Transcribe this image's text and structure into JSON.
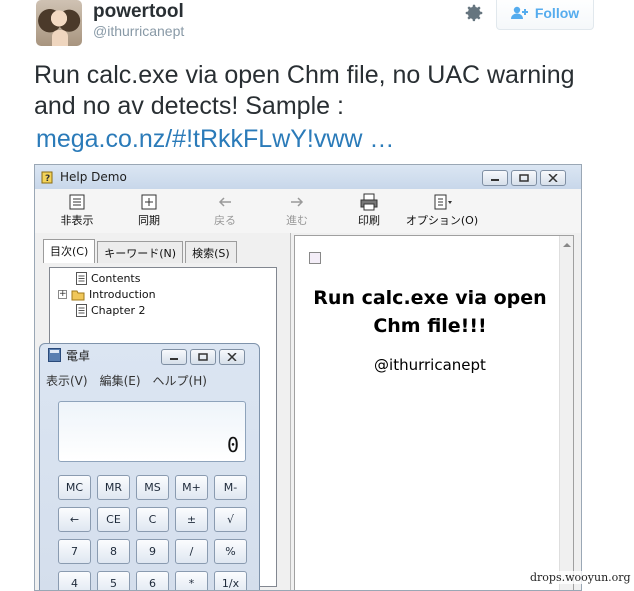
{
  "tweet": {
    "display_name": "powertool",
    "handle": "@ithurricanept",
    "follow_label": "Follow",
    "text": "Run calc.exe via open Chm file, no UAC warning and no av detects!  Sample :",
    "link": "mega.co.nz/#!tRkkFLwY!vww …"
  },
  "help_window": {
    "title": "Help Demo",
    "toolbar": {
      "hide": "非表示",
      "sync": "同期",
      "back": "戻る",
      "forward": "進む",
      "print": "印刷",
      "options": "オプション(O)"
    },
    "tabs": [
      "目次(C)",
      "キーワード(N)",
      "検索(S)"
    ],
    "tree": {
      "items": [
        {
          "label": "Contents"
        },
        {
          "label": "Introduction"
        },
        {
          "label": "Chapter 2"
        }
      ]
    },
    "content": {
      "title": "Run calc.exe via open Chm file!!!",
      "handle": "@ithurricanept"
    }
  },
  "calculator": {
    "title": "電卓",
    "menu": [
      "表示(V)",
      "編集(E)",
      "ヘルプ(H)"
    ],
    "display_value": "0",
    "keys": [
      [
        "MC",
        "MR",
        "MS",
        "M+",
        "M-"
      ],
      [
        "←",
        "CE",
        "C",
        "±",
        "√"
      ],
      [
        "7",
        "8",
        "9",
        "/",
        "%"
      ],
      [
        "4",
        "5",
        "6",
        "*",
        "1/x"
      ]
    ]
  },
  "watermark": "drops.wooyun.org",
  "icons": {
    "settings": "gear-icon",
    "follow": "add-user-icon",
    "help": "help-book-icon",
    "calculator": "calculator-icon"
  },
  "colors": {
    "link": "#2b7bb9",
    "follow_text": "#55acee",
    "handle": "#8899a6"
  }
}
